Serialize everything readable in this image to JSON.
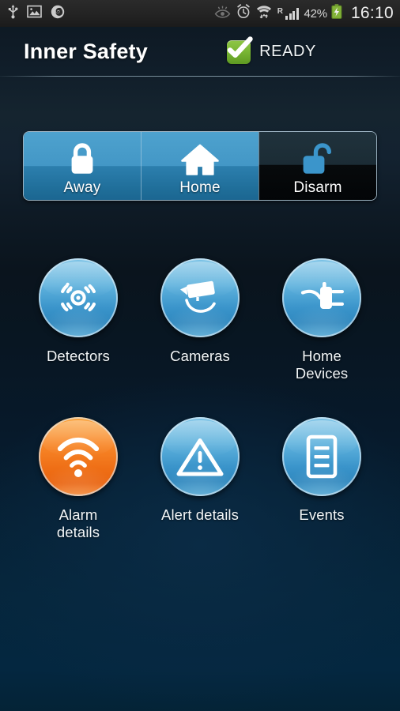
{
  "statusbar": {
    "left_icons": [
      {
        "name": "usb-icon",
        "label": "USB connected"
      },
      {
        "name": "gallery-image-icon",
        "label": "Screenshot captured"
      },
      {
        "name": "firefox-browser-icon",
        "label": "Firefox"
      }
    ],
    "right_icons": [
      {
        "name": "smart-stay-eye-icon",
        "label": "Smart stay"
      },
      {
        "name": "alarm-clock-icon",
        "label": "Alarm set"
      },
      {
        "name": "wifi-icon",
        "label": "Wi-Fi connected"
      },
      {
        "name": "roaming-indicator",
        "label": "R"
      },
      {
        "name": "signal-bars-icon",
        "label": "Signal"
      }
    ],
    "battery_percent": "42%",
    "battery_state": "charging",
    "clock": "16:10"
  },
  "header": {
    "title": "Inner Safety",
    "status_label": "READY",
    "status_icon": "green-check-badge-icon",
    "status_color": "#79b634"
  },
  "modes": {
    "selected": "Disarm",
    "items": [
      {
        "label": "Away",
        "icon": "closed-padlock-icon",
        "selected": false
      },
      {
        "label": "Home",
        "icon": "house-icon",
        "selected": false
      },
      {
        "label": "Disarm",
        "icon": "open-padlock-icon",
        "selected": true
      }
    ]
  },
  "tiles": [
    {
      "label": "Detectors",
      "icon": "motion-detector-icon",
      "color": "blue"
    },
    {
      "label": "Cameras",
      "icon": "security-camera-icon",
      "color": "blue"
    },
    {
      "label": "Home\nDevices",
      "icon": "power-plug-icon",
      "color": "blue"
    },
    {
      "label": "Alarm\ndetails",
      "icon": "siren-waves-icon",
      "color": "orange"
    },
    {
      "label": "Alert details",
      "icon": "warning-triangle-icon",
      "color": "blue"
    },
    {
      "label": "Events",
      "icon": "document-list-icon",
      "color": "blue"
    }
  ],
  "theme": {
    "accent_blue": "#3b95cb",
    "accent_orange": "#ef6f16",
    "status_green": "#79b634",
    "background_top": "#0d1720",
    "background_bottom": "#042740"
  }
}
